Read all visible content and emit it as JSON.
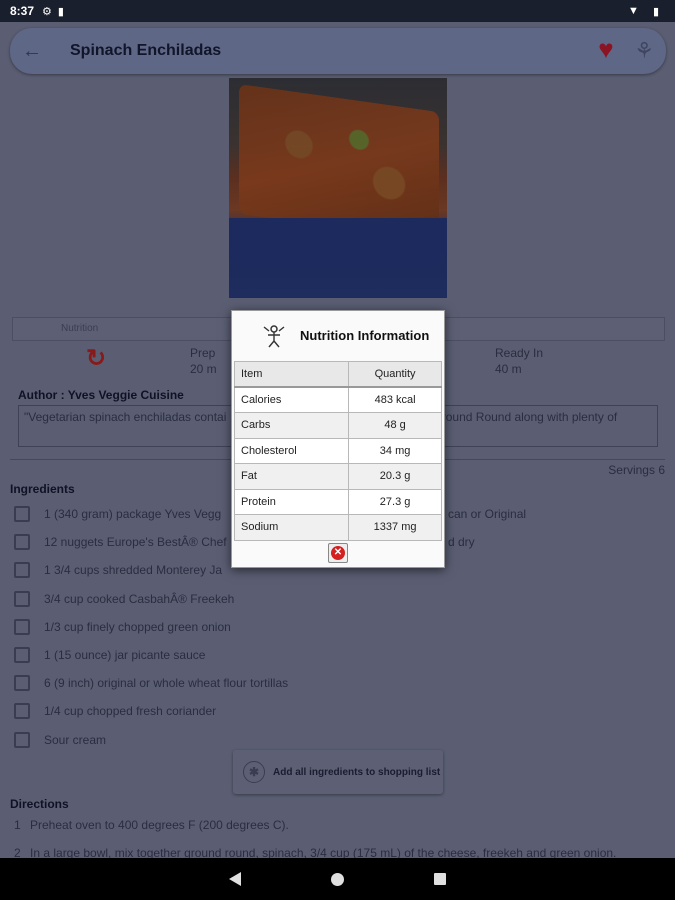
{
  "status_bar": {
    "time": "8:37"
  },
  "toolbar": {
    "title": "Spinach Enchiladas"
  },
  "tabs": {
    "left": "Nutrition",
    "right": ""
  },
  "times": {
    "prep_label": "Prep",
    "prep_value": "20 m",
    "ready_label": "Ready In",
    "ready_value": "40 m"
  },
  "author": "Author : Yves Veggie Cuisine",
  "description": "\"Vegetarian spinach enchiladas contai",
  "description_tail": "t, and Mexican Veggie Ground Round along with plenty of picante sauce and",
  "servings": "Servings 6",
  "ingredients_header": "Ingredients",
  "ingredients": [
    "1 (340 gram) package Yves Vegg",
    "12 nuggets Europe's BestÂ® Chef",
    "1 3/4 cups shredded Monterey Ja",
    "3/4 cup cooked CasbahÂ® Freekeh",
    "1/3 cup finely chopped green onion",
    "1 (15 ounce) jar picante sauce",
    "6 (9 inch) original or whole wheat flour tortillas",
    "1/4 cup chopped fresh coriander",
    "Sour cream"
  ],
  "ingredients_tail": {
    "row0": "can or Original",
    "row1": "d dry"
  },
  "add_button": "Add all ingredients to shopping list",
  "directions_header": "Directions",
  "directions": [
    {
      "num": "1",
      "text": "Preheat oven to 400 degrees F (200 degrees C)."
    },
    {
      "num": "2",
      "text": "In a large bowl, mix together ground round, spinach, 3/4 cup (175 mL) of the cheese, freekeh and green onion."
    }
  ],
  "dialog": {
    "title": "Nutrition Information",
    "col_item": "Item",
    "col_quantity": "Quantity",
    "rows": [
      {
        "item": "Calories",
        "qty": "483 kcal"
      },
      {
        "item": "Carbs",
        "qty": "48 g"
      },
      {
        "item": "Cholesterol",
        "qty": "34 mg"
      },
      {
        "item": "Fat",
        "qty": "20.3 g"
      },
      {
        "item": "Protein",
        "qty": "27.3 g"
      },
      {
        "item": "Sodium",
        "qty": "1337 mg"
      }
    ]
  },
  "colors": {
    "heart": "#8a1324",
    "refresh": "#8a1a1a",
    "close": "#d32020",
    "scrim": "#5b5e73"
  }
}
